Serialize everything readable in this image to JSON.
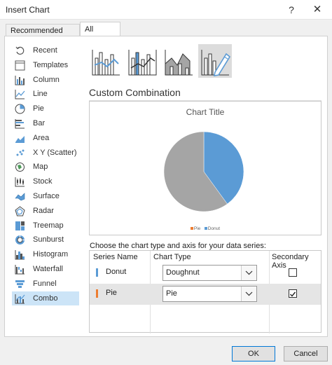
{
  "window": {
    "title": "Insert Chart",
    "help": "?",
    "close": "✕"
  },
  "tabs": [
    {
      "label": "Recommended Charts"
    },
    {
      "label": "All Charts"
    }
  ],
  "sidebar": {
    "items": [
      {
        "label": "Recent",
        "icon": "recent-icon"
      },
      {
        "label": "Templates",
        "icon": "templates-icon"
      },
      {
        "label": "Column",
        "icon": "column-chart-icon"
      },
      {
        "label": "Line",
        "icon": "line-chart-icon"
      },
      {
        "label": "Pie",
        "icon": "pie-chart-icon"
      },
      {
        "label": "Bar",
        "icon": "bar-chart-icon"
      },
      {
        "label": "Area",
        "icon": "area-chart-icon"
      },
      {
        "label": "X Y (Scatter)",
        "icon": "scatter-chart-icon"
      },
      {
        "label": "Map",
        "icon": "map-chart-icon"
      },
      {
        "label": "Stock",
        "icon": "stock-chart-icon"
      },
      {
        "label": "Surface",
        "icon": "surface-chart-icon"
      },
      {
        "label": "Radar",
        "icon": "radar-chart-icon"
      },
      {
        "label": "Treemap",
        "icon": "treemap-chart-icon"
      },
      {
        "label": "Sunburst",
        "icon": "sunburst-chart-icon"
      },
      {
        "label": "Histogram",
        "icon": "histogram-chart-icon"
      },
      {
        "label": "Waterfall",
        "icon": "waterfall-chart-icon"
      },
      {
        "label": "Funnel",
        "icon": "funnel-chart-icon"
      },
      {
        "label": "Combo",
        "icon": "combo-chart-icon"
      }
    ],
    "selected": "Combo"
  },
  "combo_section_title": "Custom Combination",
  "preview": {
    "chart_title": "Chart Title",
    "legend": [
      {
        "label": "Pie",
        "color": "#ed7d31"
      },
      {
        "label": "Donut",
        "color": "#5b9bd5"
      }
    ]
  },
  "chart_data": {
    "type": "pie",
    "title": "Chart Title",
    "series": [
      {
        "name": "Donut",
        "values": [
          40,
          60
        ],
        "colors": [
          "#5b9bd5",
          "#a5a5a5"
        ]
      }
    ],
    "legend": [
      "Pie",
      "Donut"
    ],
    "legend_position": "bottom"
  },
  "series_table": {
    "instruction": "Choose the chart type and axis for your data series:",
    "headers": {
      "name": "Series Name",
      "type": "Chart Type",
      "axis": "Secondary Axis"
    },
    "rows": [
      {
        "name": "Donut",
        "color": "#5b9bd5",
        "chart_type": "Doughnut",
        "secondary_axis": false
      },
      {
        "name": "Pie",
        "color": "#ed7d31",
        "chart_type": "Pie",
        "secondary_axis": true
      }
    ]
  },
  "buttons": {
    "ok": "OK",
    "cancel": "Cancel"
  },
  "colors": {
    "accent": "#0078d7",
    "selection": "#cce4f7",
    "blue": "#5b9bd5",
    "orange": "#ed7d31",
    "gray": "#a5a5a5"
  }
}
